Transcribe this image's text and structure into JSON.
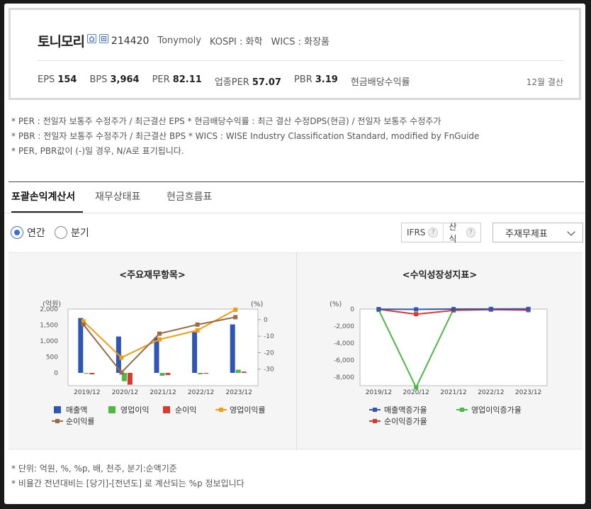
{
  "header": {
    "company_name": "토니모리",
    "code": "214420",
    "english_name": "Tonymoly",
    "market": "KOSPI : 화학",
    "wics": "WICS : 화장품",
    "metrics": [
      {
        "label": "EPS",
        "value": "154"
      },
      {
        "label": "BPS",
        "value": "3,964"
      },
      {
        "label": "PER",
        "value": "82.11"
      },
      {
        "label": "업종PER",
        "value": "57.07"
      },
      {
        "label": "PBR",
        "value": "3.19"
      },
      {
        "label": "현금배당수익률",
        "value": ""
      }
    ],
    "settlement": "12월 결산"
  },
  "notes": [
    "* PER : 전일자 보통주 수정주가 / 최근결산 EPS * 현금배당수익률 : 최근 결산 수정DPS(현금) / 전일자 보통주 수정주가",
    "* PBR : 전일자 보통주 수정주가 / 최근결산 BPS * WICS : WISE Industry Classification Standard, modified by FnGuide",
    "* PER, PBR값이 (-)일 경우, N/A로 표기됩니다."
  ],
  "tabs": [
    "포괄손익계산서",
    "재무상태표",
    "현금흐름표"
  ],
  "controls": {
    "radio_annual": "연간",
    "radio_quarter": "분기",
    "ifrs": "IFRS",
    "calc": "산식",
    "help": "?",
    "select_value": "주재무제표"
  },
  "colors": {
    "revenue": "#2f56b5",
    "operating_profit": "#4cb944",
    "net_income": "#d73a2e",
    "op_margin": "#f39c12",
    "net_margin": "#9b6a46",
    "rev_growth": "#2f56b5",
    "op_growth": "#4cb944",
    "ni_growth": "#d73a2e"
  },
  "chart_data": [
    {
      "type": "bar",
      "title": "<주요재무항목>",
      "categories": [
        "2019/12",
        "2020/12",
        "2021/12",
        "2022/12",
        "2023/12"
      ],
      "y_left_label": "(억원)",
      "y_right_label": "(%)",
      "y_left_ticks": [
        "2,000",
        "1,500",
        "1,000",
        "500",
        "0"
      ],
      "y_right_ticks": [
        "0",
        "-10",
        "-20",
        "-30"
      ],
      "ylim_left": [
        -400,
        2000
      ],
      "ylim_right": [
        -40,
        6.4
      ],
      "series": [
        {
          "name": "매출액",
          "kind": "bar",
          "axis": "left",
          "values": [
            1720,
            1140,
            1120,
            1280,
            1520
          ]
        },
        {
          "name": "영업이익",
          "kind": "bar",
          "axis": "left",
          "values": [
            -10,
            -260,
            -90,
            -45,
            100
          ]
        },
        {
          "name": "순이익",
          "kind": "bar",
          "axis": "left",
          "values": [
            -45,
            -370,
            -65,
            -25,
            40
          ]
        },
        {
          "name": "영업이익률",
          "kind": "line",
          "axis": "right",
          "values": [
            -1,
            -23,
            -12,
            -6.5,
            6
          ]
        },
        {
          "name": "순이익률",
          "kind": "line",
          "axis": "right",
          "values": [
            -3,
            -32,
            -8.5,
            -3,
            1.5
          ]
        }
      ]
    },
    {
      "type": "line",
      "title": "<수익성장성지표>",
      "categories": [
        "2019/12",
        "2020/12",
        "2021/12",
        "2022/12",
        "2023/12"
      ],
      "y_label": "(%)",
      "y_ticks": [
        "0",
        "-2,000",
        "-4,000",
        "-6,000",
        "-8,000"
      ],
      "ylim": [
        -9000,
        0
      ],
      "series": [
        {
          "name": "매출액증가율",
          "values": [
            -8,
            -33,
            -2,
            14,
            19
          ]
        },
        {
          "name": "영업이익증가율",
          "values": [
            -100,
            -9200,
            -10,
            0,
            0
          ]
        },
        {
          "name": "순이익증가율",
          "values": [
            -20,
            -600,
            -150,
            -60,
            -120
          ]
        }
      ]
    }
  ],
  "bottom_notes": [
    "* 단위: 억원, %, %p, 배, 천주, 분기:순액기준",
    "* 비율간 전년대비는 [당기]-[전년도] 로 계산되는 %p 정보입니다"
  ]
}
